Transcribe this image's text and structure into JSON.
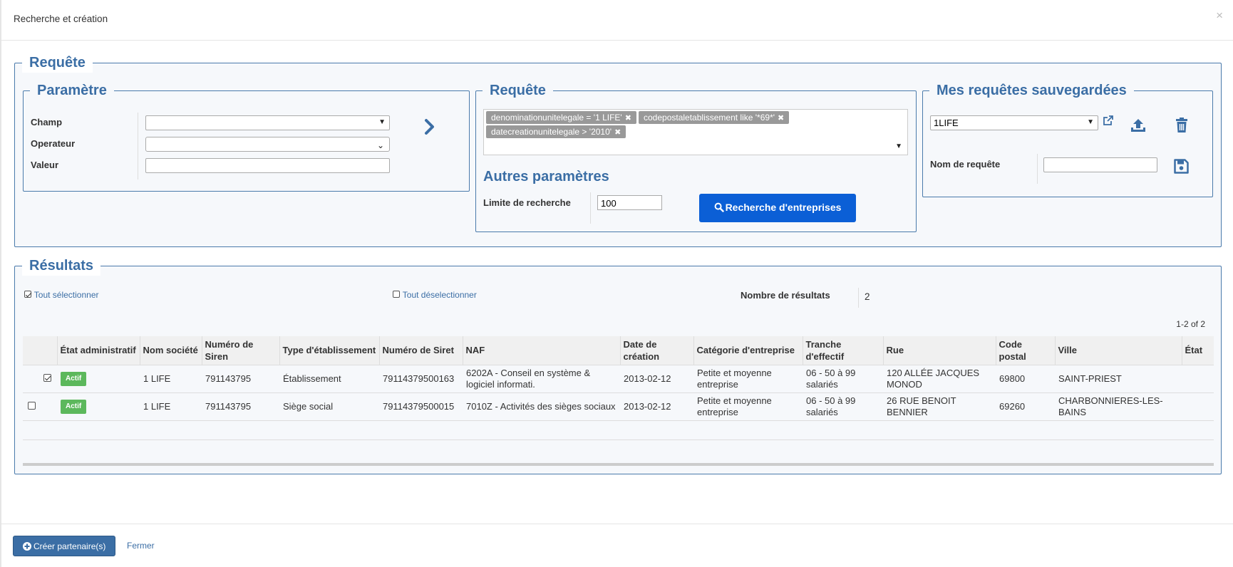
{
  "modal": {
    "title": "Recherche et création",
    "close": "×"
  },
  "requete_section": {
    "legend": "Requête"
  },
  "parametre": {
    "legend": "Paramètre",
    "champ_label": "Champ",
    "operateur_label": "Operateur",
    "valeur_label": "Valeur",
    "champ_value": "",
    "operateur_value": "",
    "valeur_value": ""
  },
  "requete": {
    "legend": "Requête",
    "tags": [
      "denominationunitelegale = '1 LIFE'",
      "codepostaletablissement like '*69*'",
      "datecreationunitelegale > '2010'"
    ],
    "autres_title": "Autres paramètres",
    "limite_label": "Limite de recherche",
    "limite_value": "100",
    "search_button": "Recherche d'entreprises"
  },
  "saved": {
    "legend": "Mes requêtes sauvegardées",
    "selected": "1LIFE",
    "nom_label": "Nom de requête",
    "nom_value": ""
  },
  "results": {
    "legend": "Résultats",
    "select_all": "Tout sélectionner",
    "deselect_all": "Tout déselectionner",
    "count_label": "Nombre de résultats",
    "count_value": "2",
    "pagination": "1-2 of 2",
    "columns": [
      "État administratif",
      "Nom société",
      "Numéro de Siren",
      "Type d'établissement",
      "Numéro de Siret",
      "NAF",
      "Date de création",
      "Catégorie d'entreprise",
      "Tranche d'effectif",
      "Rue",
      "Code postal",
      "Ville",
      "État"
    ],
    "rows": [
      {
        "checked": true,
        "etat": "Actif",
        "nom": "1 LIFE",
        "siren": "791143795",
        "type": "Établissement",
        "siret": "79114379500163",
        "naf": "6202A - Conseil en système & logiciel informati.",
        "date": "2013-02-12",
        "categorie": "Petite et moyenne entreprise",
        "tranche": "06 - 50 à 99 salariés",
        "rue": "120 ALLÉE JACQUES MONOD",
        "cp": "69800",
        "ville": "SAINT-PRIEST",
        "etat2": ""
      },
      {
        "checked": false,
        "etat": "Actif",
        "nom": "1 LIFE",
        "siren": "791143795",
        "type": "Siège social",
        "siret": "79114379500015",
        "naf": "7010Z - Activités des sièges sociaux",
        "date": "2013-02-12",
        "categorie": "Petite et moyenne entreprise",
        "tranche": "06 - 50 à 99 salariés",
        "rue": "26 RUE BENOIT BENNIER",
        "cp": "69260",
        "ville": "CHARBONNIERES-LES-BAINS",
        "etat2": ""
      }
    ]
  },
  "footer": {
    "create_button": "Créer partenaire(s)",
    "close_link": "Fermer"
  }
}
